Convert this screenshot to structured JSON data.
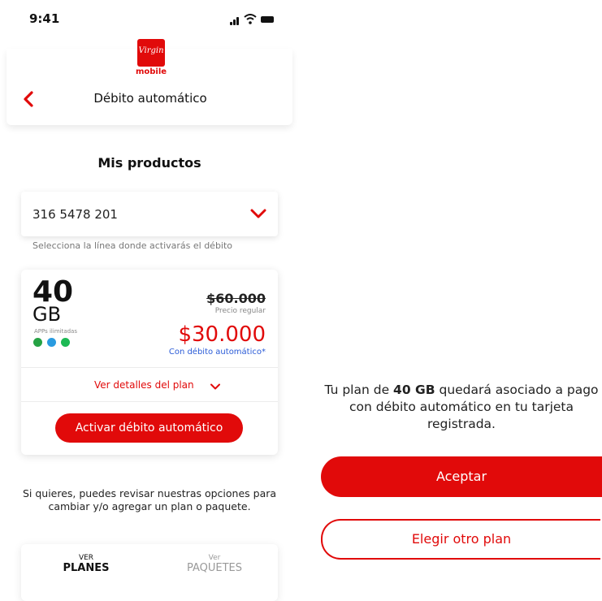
{
  "status_bar": {
    "time": "9:41"
  },
  "header": {
    "logo_text": "Virgin",
    "logo_sub": "mobile",
    "title": "Débito automático"
  },
  "products": {
    "title": "Mis productos",
    "selected_line": "316 5478 201",
    "hint": "Selecciona la línea donde activarás el débito"
  },
  "plan": {
    "gb_number": "40",
    "gb_unit": "GB",
    "apps_label": "APPs ilimitadas",
    "apps": [
      "whatsapp-icon",
      "telegram-icon",
      "spotify-icon"
    ],
    "old_price": "$60.000",
    "regular_label": "Precio regular",
    "new_price": "$30.000",
    "debit_label": "Con débito automático*",
    "details_link": "Ver detalles del plan",
    "activate_button": "Activar débito automático"
  },
  "info_text": "Si quieres, puedes revisar nuestras opciones para cambiar y/o agregar un plan o paquete.",
  "tabs": [
    {
      "small": "VER",
      "big": "PLANES"
    },
    {
      "small": "Ver",
      "big": "PAQUETES"
    }
  ],
  "confirm": {
    "text_before": "Tu plan de ",
    "text_bold": "40 GB",
    "text_after": " quedará asociado a pago con débito automático en tu tarjeta registrada.",
    "accept_button": "Aceptar",
    "other_button": "Elegir otro plan"
  },
  "colors": {
    "brand_red": "#e10a0a",
    "link_blue": "#2a5bd7"
  }
}
